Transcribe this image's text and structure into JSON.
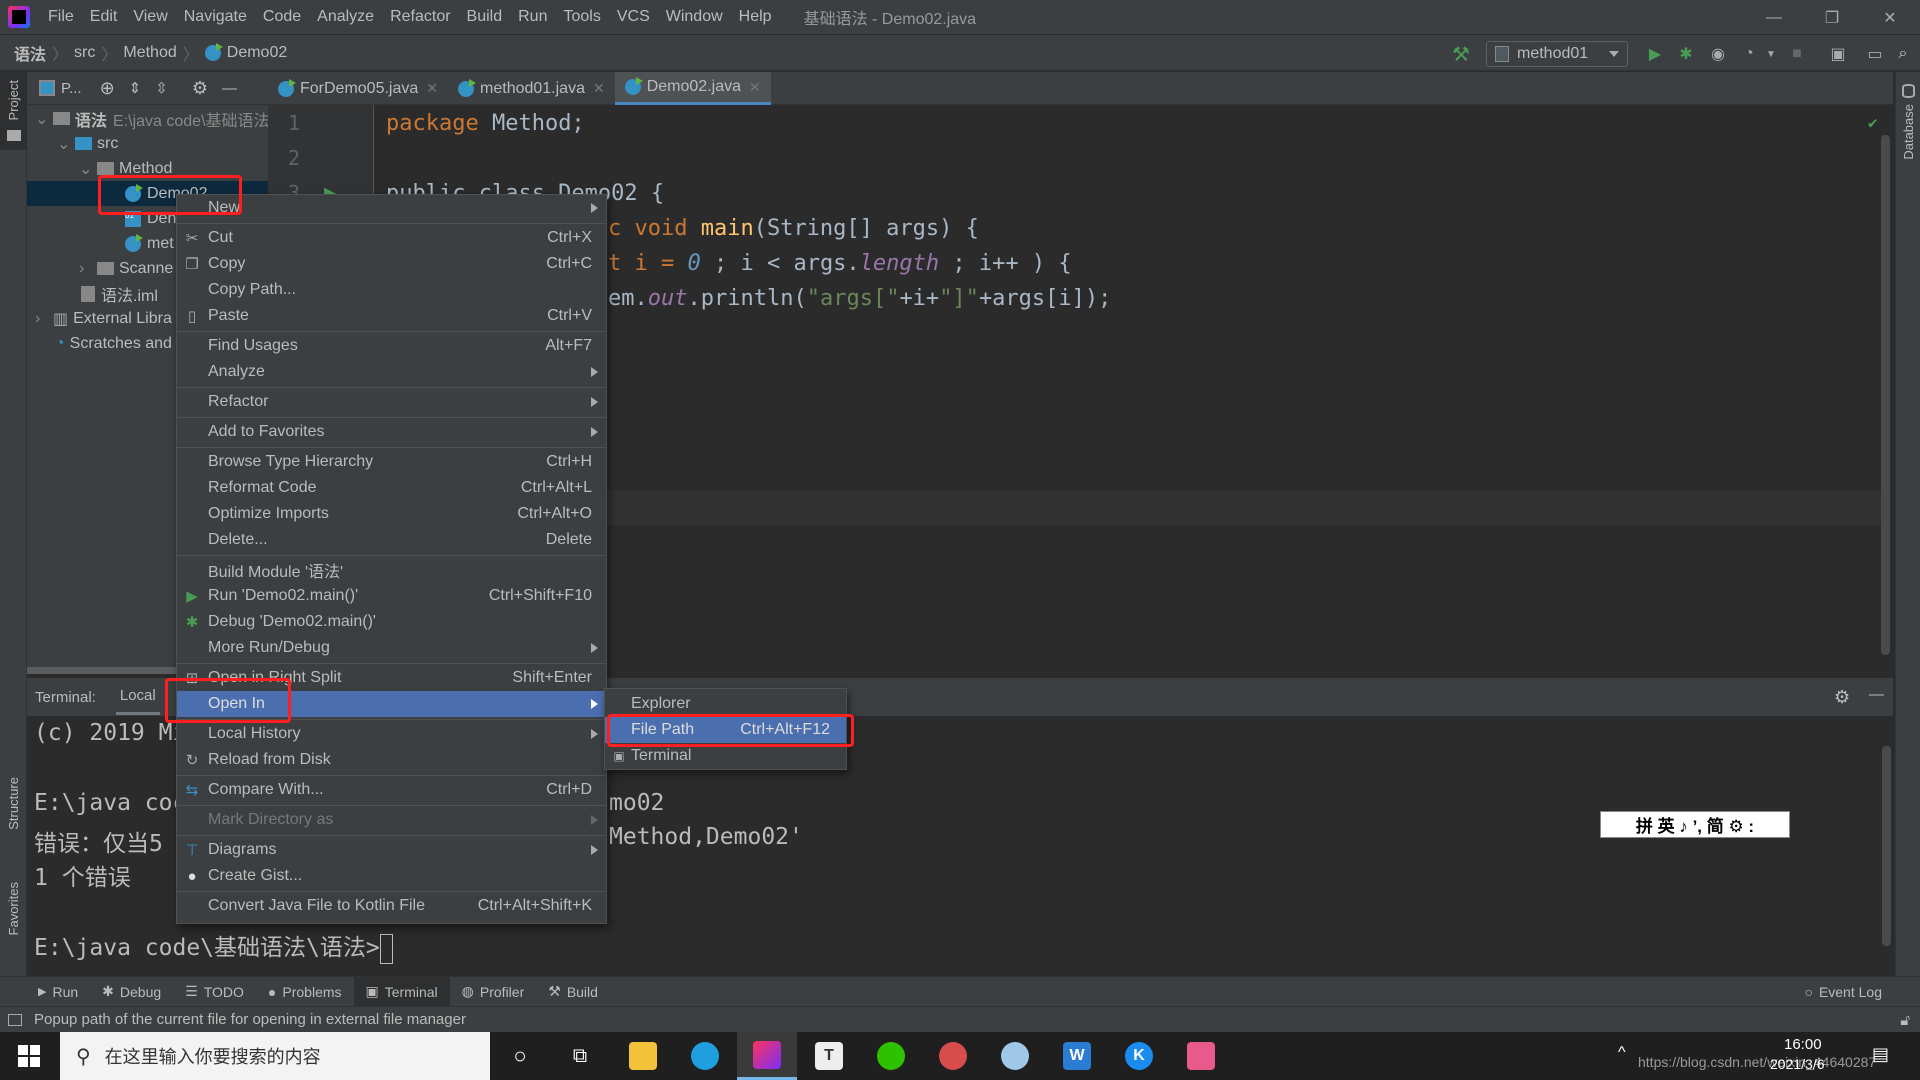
{
  "menubar": {
    "items": [
      "File",
      "Edit",
      "View",
      "Navigate",
      "Code",
      "Analyze",
      "Refactor",
      "Build",
      "Run",
      "Tools",
      "VCS",
      "Window",
      "Help"
    ],
    "window_title": "基础语法 - Demo02.java"
  },
  "window_controls": {
    "minimize": "—",
    "restore": "❐",
    "close": "✕"
  },
  "breadcrumb": [
    "语法",
    "src",
    "Method",
    "Demo02"
  ],
  "toolbar": {
    "run_config": "method01"
  },
  "left_strip": {
    "project": "Project",
    "structure": "Structure",
    "favorites": "Favorites"
  },
  "right_strip": {
    "database": "Database"
  },
  "project_panel": {
    "view_label": "P...",
    "tree": [
      {
        "label": "语法",
        "path": "E:\\java code\\基础语法",
        "expanded": true
      },
      {
        "label": "src",
        "expanded": true
      },
      {
        "label": "Method",
        "expanded": true
      },
      {
        "label": "Demo02",
        "selected": true
      },
      {
        "label": "Den"
      },
      {
        "label": "met"
      },
      {
        "label": "Scanne",
        "expanded": false
      },
      {
        "label": "语法.iml"
      },
      {
        "label": "External Libra",
        "expanded": false
      },
      {
        "label": "Scratches and"
      }
    ]
  },
  "editor_tabs": [
    {
      "label": "ForDemo05.java",
      "active": false
    },
    {
      "label": "method01.java",
      "active": false
    },
    {
      "label": "Demo02.java",
      "active": true
    }
  ],
  "editor": {
    "line_numbers": [
      "1",
      "2",
      "3"
    ],
    "lines": [
      "package Method;",
      "",
      "public class Demo02 {",
      "    public static void main(String[] args) {",
      "        for (int i = 0 ; i < args.length ; i++ ) {",
      "            System.out.println(\"args[\"+i+\"]\"+args[i]);"
    ],
    "visible_fragments": {
      "l1_kw": "package",
      "l1_rest": " Method;",
      "l3": "public class Demo02 {",
      "l4_kw": "c void ",
      "l4_fn": "main",
      "l4_rest": "(String[] args) {",
      "l5_a": "t i = ",
      "l5_num": "0",
      "l5_b": " ; i < args.",
      "l5_fld": "length",
      "l5_c": " ; i++ ) {",
      "l6_a": "em.",
      "l6_fld": "out",
      "l6_b": ".println(",
      "l6_str1": "\"args[\"",
      "l6_c": "+i+",
      "l6_str2": "\"]\"",
      "l6_d": "+args[i]);"
    }
  },
  "terminal": {
    "label": "Terminal:",
    "tab": "Local",
    "lines": [
      "(c) 2019 Mi",
      "",
      "E:\\java coc",
      "错误：仅当5",
      "1 个错误",
      "",
      "E:\\java code\\基础语法\\语法>"
    ],
    "right_fragments": [
      "mo02",
      "Method,Demo02'"
    ]
  },
  "context_menu": {
    "items": [
      {
        "label": "New",
        "submenu": true
      },
      {
        "label": "Cut",
        "shortcut": "Ctrl+X",
        "icon": "scissors-icon"
      },
      {
        "label": "Copy",
        "shortcut": "Ctrl+C",
        "icon": "copy-icon"
      },
      {
        "label": "Copy Path..."
      },
      {
        "label": "Paste",
        "shortcut": "Ctrl+V",
        "icon": "paste-icon"
      },
      {
        "label": "Find Usages",
        "shortcut": "Alt+F7"
      },
      {
        "label": "Analyze",
        "submenu": true
      },
      {
        "label": "Refactor",
        "submenu": true
      },
      {
        "label": "Add to Favorites",
        "submenu": true
      },
      {
        "label": "Browse Type Hierarchy",
        "shortcut": "Ctrl+H"
      },
      {
        "label": "Reformat Code",
        "shortcut": "Ctrl+Alt+L"
      },
      {
        "label": "Optimize Imports",
        "shortcut": "Ctrl+Alt+O"
      },
      {
        "label": "Delete...",
        "shortcut": "Delete"
      },
      {
        "label": "Build Module '语法'"
      },
      {
        "label": "Run 'Demo02.main()'",
        "shortcut": "Ctrl+Shift+F10",
        "icon": "run-icon"
      },
      {
        "label": "Debug 'Demo02.main()'",
        "icon": "debug-icon"
      },
      {
        "label": "More Run/Debug",
        "submenu": true
      },
      {
        "label": "Open in Right Split",
        "shortcut": "Shift+Enter",
        "icon": "split-icon"
      },
      {
        "label": "Open In",
        "submenu": true,
        "highlighted": true
      },
      {
        "label": "Local History",
        "submenu": true
      },
      {
        "label": "Reload from Disk",
        "icon": "reload-icon"
      },
      {
        "label": "Compare With...",
        "shortcut": "Ctrl+D",
        "icon": "compare-icon"
      },
      {
        "label": "Mark Directory as",
        "submenu": true,
        "disabled": true
      },
      {
        "label": "Diagrams",
        "submenu": true,
        "icon": "diagram-icon"
      },
      {
        "label": "Create Gist...",
        "icon": "github-icon"
      },
      {
        "label": "Convert Java File to Kotlin File",
        "shortcut": "Ctrl+Alt+Shift+K"
      }
    ]
  },
  "open_in_submenu": {
    "items": [
      {
        "label": "Explorer"
      },
      {
        "label": "File Path",
        "shortcut": "Ctrl+Alt+F12",
        "highlighted": true
      },
      {
        "label": "Terminal",
        "icon": "terminal-icon"
      }
    ]
  },
  "bottom_tabs": [
    {
      "label": "Run",
      "icon": "run-icon"
    },
    {
      "label": "Debug",
      "icon": "debug-icon"
    },
    {
      "label": "TODO",
      "icon": "list-icon"
    },
    {
      "label": "Problems",
      "icon": "problems-icon"
    },
    {
      "label": "Terminal",
      "icon": "terminal-icon",
      "active": true
    },
    {
      "label": "Profiler",
      "icon": "profiler-icon"
    },
    {
      "label": "Build",
      "icon": "build-icon"
    }
  ],
  "event_log": "Event Log",
  "status_text": "Popup path of the current file for opening in external file manager",
  "ime_bar": "拼 英 ♪ ’, 简 ⚙ :",
  "taskbar": {
    "search_placeholder": "在这里输入你要搜索的内容",
    "time": "16:00",
    "date": "2021/3/6",
    "watermark": "https://blog.csdn.net/weixin_44640287"
  },
  "colors": {
    "accent": "#4b6eaf",
    "highlight_box": "#ff1f1f",
    "run_green": "#499c54"
  }
}
